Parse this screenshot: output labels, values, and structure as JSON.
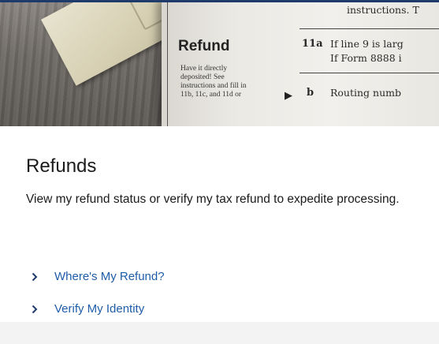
{
  "hero": {
    "form_heading": "Refund",
    "form_note": "Have it directly deposited! See instructions and fill in 11b, 11c, and 11d or",
    "line_10_text": "instructions. T",
    "line_11a_label": "11a",
    "line_11a_text_1": "If line 9 is larg",
    "line_11a_text_2": "If Form 8888 i",
    "line_b_label": "b",
    "line_b_text": "Routing numb"
  },
  "card": {
    "title": "Refunds",
    "description": "View my refund status or verify my tax refund to expedite processing.",
    "links": [
      {
        "label": "Where's My Refund?"
      },
      {
        "label": "Verify My Identity"
      }
    ]
  },
  "colors": {
    "link": "#1f5da8",
    "text": "#1b1b1b",
    "chevron": "#1f3b6b",
    "top_rule": "#1f3b6b"
  },
  "icons": {
    "link_chevron": "chevron-right-icon",
    "deposit_arrow": "arrow-right-icon"
  }
}
